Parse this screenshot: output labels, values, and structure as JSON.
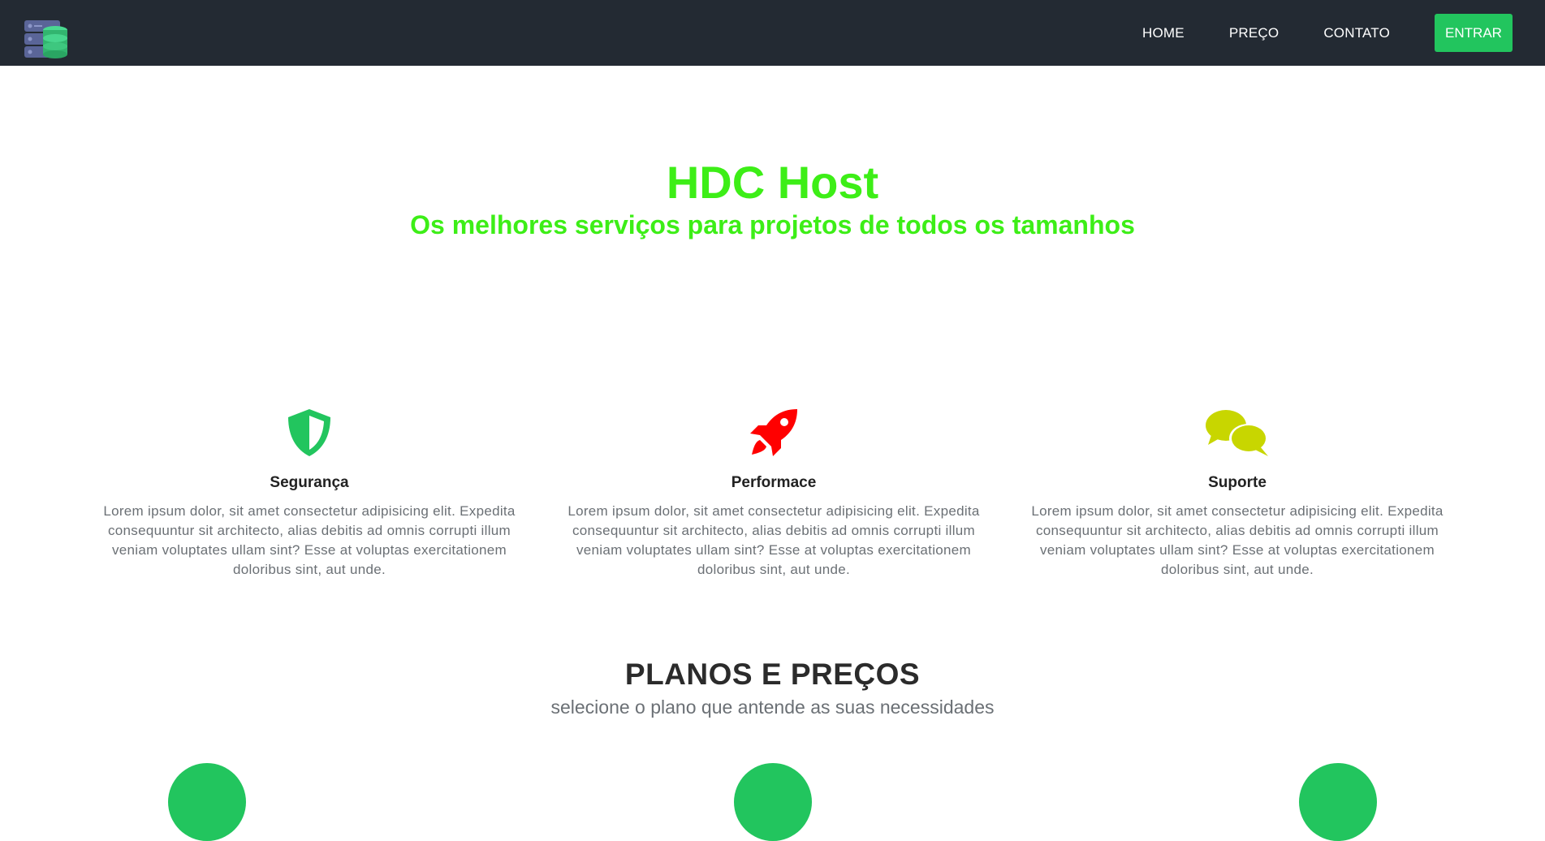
{
  "nav": {
    "links": [
      "HOME",
      "PREÇO",
      "CONTATO"
    ],
    "login_label": "ENTRAR"
  },
  "hero": {
    "title": "HDC Host",
    "subtitle": "Os melhores serviços para projetos de todos os tamanhos"
  },
  "features": [
    {
      "icon": "shield-icon",
      "title": "Segurança",
      "text": "Lorem ipsum dolor, sit amet consectetur adipisicing elit. Expedita consequuntur sit architecto, alias debitis ad omnis corrupti illum veniam voluptates ullam sint? Esse at voluptas exercitationem doloribus sint, aut unde."
    },
    {
      "icon": "rocket-icon",
      "title": "Performace",
      "text": "Lorem ipsum dolor, sit amet consectetur adipisicing elit. Expedita consequuntur sit architecto, alias debitis ad omnis corrupti illum veniam voluptates ullam sint? Esse at voluptas exercitationem doloribus sint, aut unde."
    },
    {
      "icon": "chat-icon",
      "title": "Suporte",
      "text": "Lorem ipsum dolor, sit amet consectetur adipisicing elit. Expedita consequuntur sit architecto, alias debitis ad omnis corrupti illum veniam voluptates ullam sint? Esse at voluptas exercitationem doloribus sint, aut unde."
    }
  ],
  "plans": {
    "title": "PLANOS E PREÇOS",
    "subtitle": "selecione o plano que antende as suas necessidades"
  },
  "colors": {
    "navbar": "#232a33",
    "accent_green": "#22c55e",
    "hero_green": "#3dee17",
    "shield": "#22c55e",
    "rocket": "#ff0000",
    "chat": "#c8d600"
  }
}
